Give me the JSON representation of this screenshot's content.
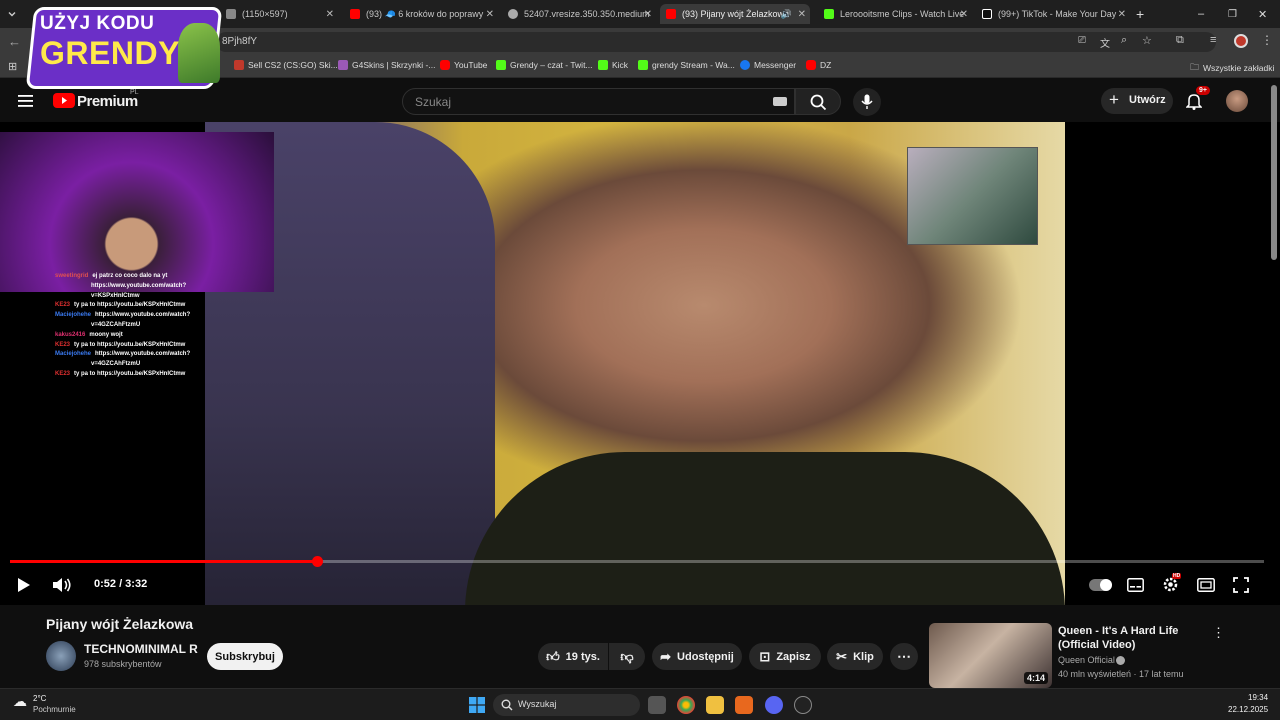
{
  "browser": {
    "tabs": [
      {
        "title": "(1150×597)",
        "color": "#888"
      },
      {
        "title": "(93) 🧢 6 kroków do poprawy",
        "color": "#ff0000"
      },
      {
        "title": "52407.vresize.350.350.medium",
        "color": "#aaa"
      },
      {
        "title": "(93) Pijany wójt Żelazkowa",
        "color": "#ff0000"
      },
      {
        "title": "Leroooitsme Clips - Watch Live",
        "color": "#53fc18"
      },
      {
        "title": "(99+) TikTok - Make Your Day",
        "color": "#ffffff"
      }
    ],
    "url": "8Pjh8fY",
    "bookmarks": [
      "Sell CS2 (CS:GO) Ski...",
      "G4Skins | Skrzynki -...",
      "YouTube",
      "Grendy – czat - Twit...",
      "Kick",
      "grendy Stream - Wa...",
      "Messenger",
      "DZ"
    ],
    "all_bookmarks": "Wszystkie zakładki",
    "promo_line1": "UŻYJ KODU",
    "promo_line2": "GRENDY"
  },
  "youtube": {
    "logo": "Premium",
    "region": "PL",
    "search_placeholder": "Szukaj",
    "create_label": "Utwórz",
    "notif_count": "9+"
  },
  "player": {
    "time": "0:52 / 3:32",
    "progress": 0.245
  },
  "stream_chat": [
    {
      "user": "sweetingrid",
      "msg": "ej patrz co coco dalo na yt",
      "color": "#e05050"
    },
    {
      "user": "",
      "msg": "https://www.youtube.com/watch?",
      "color": "#fff"
    },
    {
      "user": "",
      "msg": "v=KSPxHnICtmw",
      "color": "#fff"
    },
    {
      "user": "KE23",
      "msg": "ty pa to https://youtu.be/KSPxHnICtmw",
      "color": "#e03030"
    },
    {
      "user": "Maciejohehe",
      "msg": "https://www.youtube.com/watch?",
      "color": "#3a7af0"
    },
    {
      "user": "",
      "msg": "v=4GZCAhFtzmU",
      "color": "#fff"
    },
    {
      "user": "kakus2416",
      "msg": "moony wojt",
      "color": "#e03070"
    },
    {
      "user": "KE23",
      "msg": "ty pa to https://youtu.be/KSPxHnICtmw",
      "color": "#e03030"
    },
    {
      "user": "Maciejohehe",
      "msg": "https://www.youtube.com/watch?",
      "color": "#3a7af0"
    },
    {
      "user": "",
      "msg": "v=4GZCAhFtzmU",
      "color": "#fff"
    },
    {
      "user": "KE23",
      "msg": "ty pa to https://youtu.be/KSPxHnICtmw",
      "color": "#e03030"
    }
  ],
  "video": {
    "title": "Pijany wójt Żelazkowa",
    "channel": "TECHNOMINIMAL R",
    "subscribers": "978 subskrybentów",
    "subscribe_label": "Subskrybuj",
    "likes": "19 tys.",
    "share_label": "Udostępnij",
    "save_label": "Zapisz",
    "clip_label": "Klip"
  },
  "recommended": {
    "title": "Queen - It's A Hard Life (Official Video)",
    "channel": "Queen Official",
    "meta": "40 mln wyświetleń · 17 lat temu",
    "duration": "4:14"
  },
  "taskbar": {
    "weather_temp": "2°C",
    "weather_desc": "Pochmurnie",
    "search_label": "Wyszukaj",
    "time": "19:34",
    "date": "22.12.2025"
  }
}
